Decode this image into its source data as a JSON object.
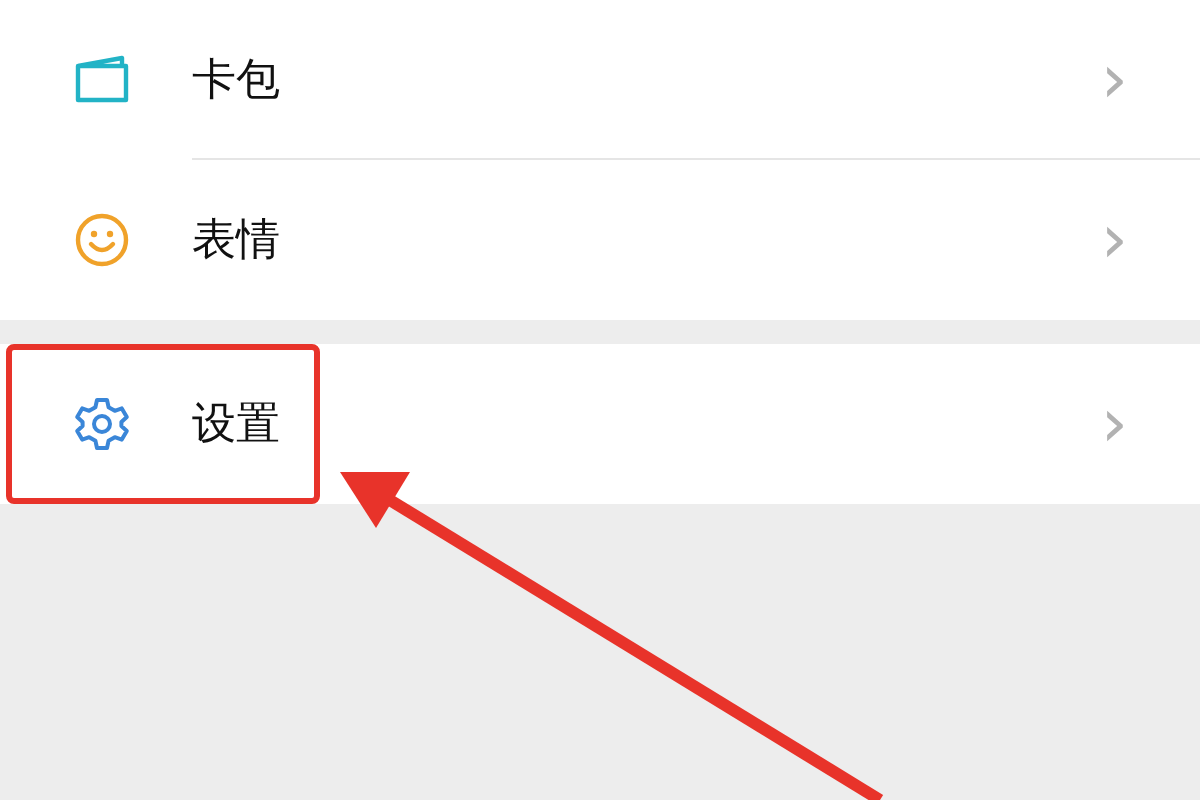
{
  "menu_groups": [
    {
      "items": [
        {
          "label": "卡包",
          "chevron": "›"
        },
        {
          "label": "表情",
          "chevron": "›"
        }
      ]
    },
    {
      "items": [
        {
          "label": "设置",
          "chevron": "›"
        }
      ]
    }
  ],
  "annotations": {
    "highlight_box": true,
    "arrow": true
  }
}
